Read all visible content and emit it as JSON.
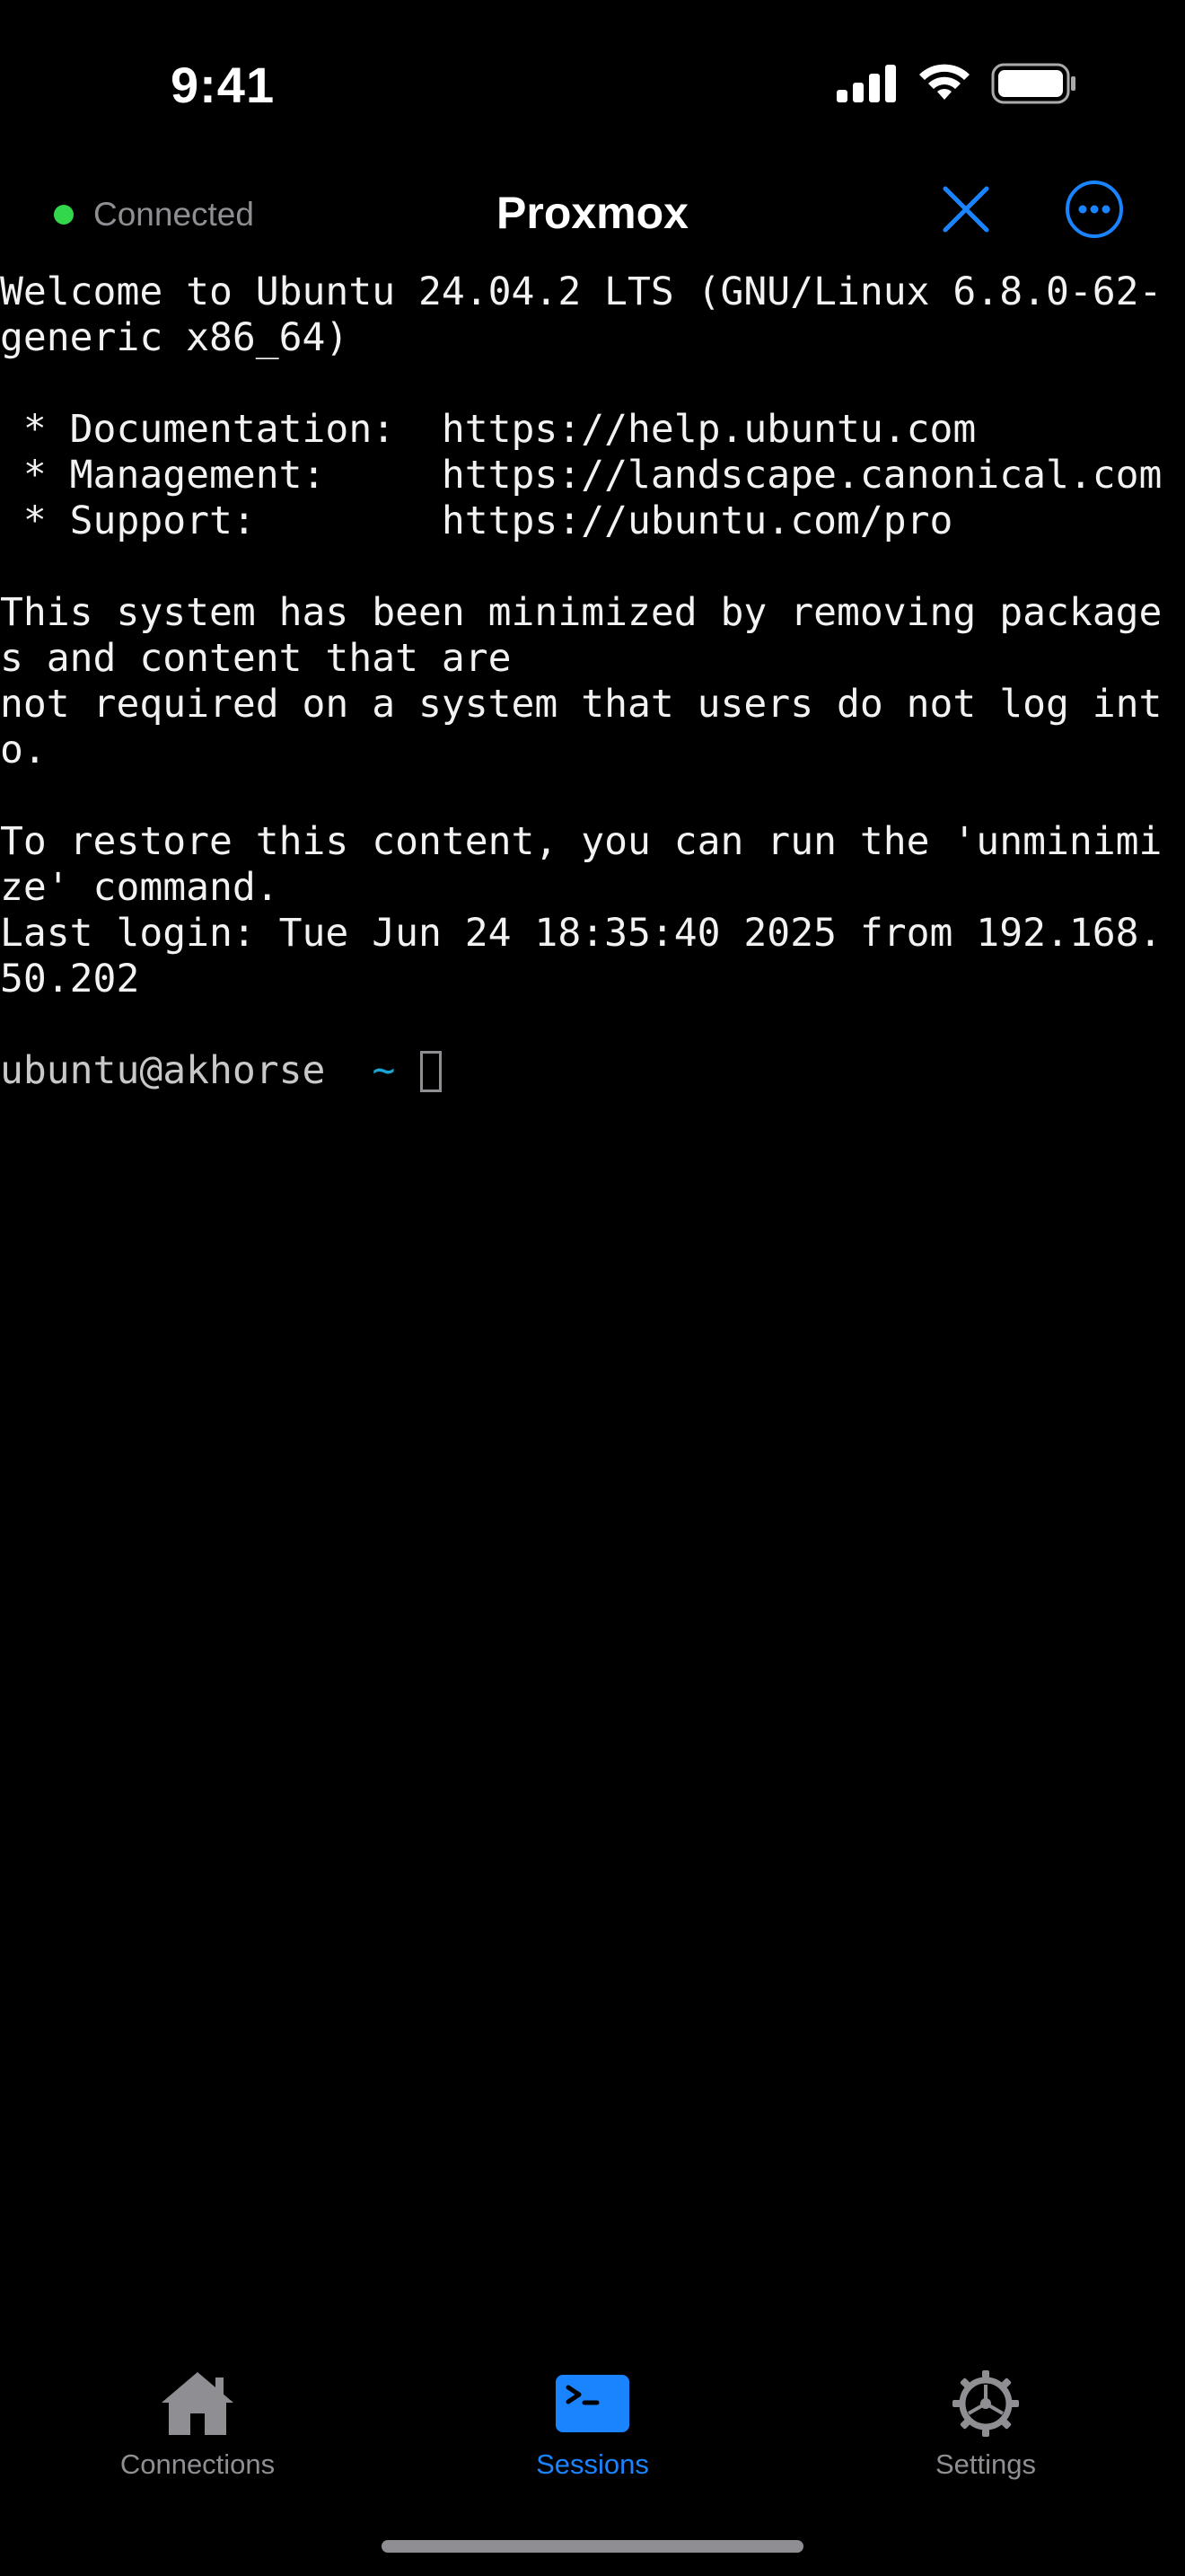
{
  "status_bar": {
    "time": "9:41",
    "icons": [
      "cellular-signal-icon",
      "wifi-icon",
      "battery-icon"
    ]
  },
  "nav": {
    "connection_status": "Connected",
    "title": "Proxmox",
    "close_icon": "close-icon",
    "more_icon": "more-icon"
  },
  "terminal": {
    "lines": [
      "Welcome to Ubuntu 24.04.2 LTS (GNU/Linux 6.8.0-62-",
      "generic x86_64)",
      "",
      " * Documentation:  https://help.ubuntu.com",
      " * Management:     https://landscape.canonical.com",
      " * Support:        https://ubuntu.com/pro",
      "",
      "This system has been minimized by removing package",
      "s and content that are",
      "not required on a system that users do not log int",
      "o.",
      "",
      "To restore this content, you can run the 'unminimi",
      "ze' command.",
      "Last login: Tue Jun 24 18:35:40 2025 from 192.168.",
      "50.202",
      ""
    ],
    "prompt_user": "ubuntu@akhorse",
    "prompt_dir": "~"
  },
  "tabs": [
    {
      "label": "Connections",
      "icon": "house-icon",
      "active": false
    },
    {
      "label": "Sessions",
      "icon": "terminal-icon",
      "active": true
    },
    {
      "label": "Settings",
      "icon": "gear-icon",
      "active": false
    }
  ],
  "colors": {
    "accent": "#1a84ff",
    "connected": "#32d74b",
    "inactive": "#8e8e93",
    "prompt_dir": "#19a6d6"
  }
}
